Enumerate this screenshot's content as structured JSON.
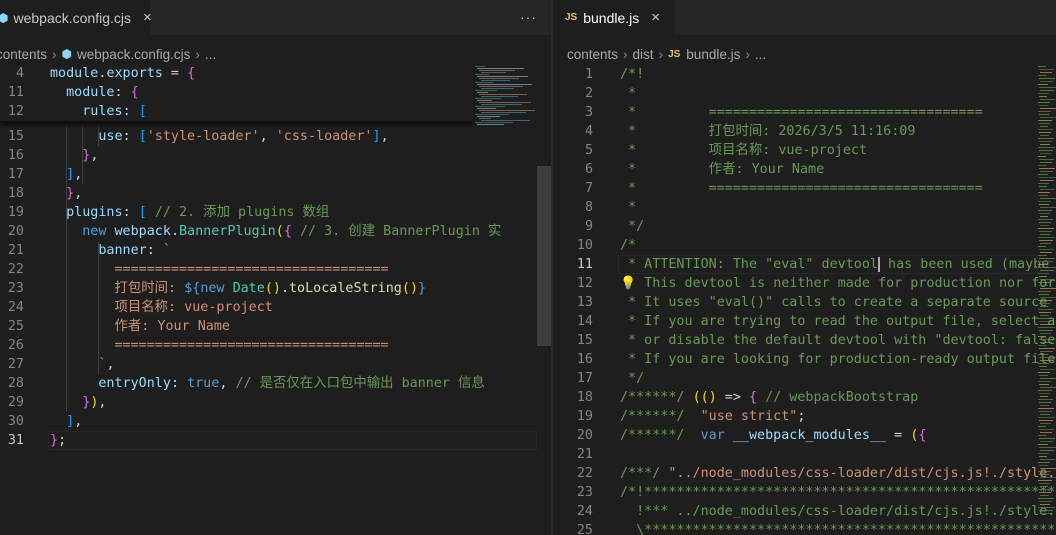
{
  "left_pane": {
    "tab": {
      "icon": "webpack-icon",
      "label": "webpack.config.cjs",
      "close": "×"
    },
    "more": "···",
    "breadcrumb": {
      "items": [
        "contents",
        "webpack.config.cjs",
        "..."
      ]
    },
    "sticky": [
      {
        "ln": "4",
        "code": "module.exports = {"
      },
      {
        "ln": "11",
        "code": "  module: {"
      },
      {
        "ln": "12",
        "code": "    rules: ["
      }
    ],
    "lines": [
      {
        "ln": "15",
        "code": "      use: ['style-loader', 'css-loader'],"
      },
      {
        "ln": "16",
        "code": "    },"
      },
      {
        "ln": "17",
        "code": "  ],"
      },
      {
        "ln": "18",
        "code": "  },"
      },
      {
        "ln": "19",
        "code": "  plugins: [ // 2. 添加 plugins 数组"
      },
      {
        "ln": "20",
        "code": "    new webpack.BannerPlugin({ // 3. 创建 BannerPlugin 实"
      },
      {
        "ln": "21",
        "code": "      banner: `"
      },
      {
        "ln": "22",
        "code": "        =================================="
      },
      {
        "ln": "23",
        "code": "        打包时间: ${new Date().toLocaleString()}"
      },
      {
        "ln": "24",
        "code": "        项目名称: vue-project"
      },
      {
        "ln": "25",
        "code": "        作者: Your Name"
      },
      {
        "ln": "26",
        "code": "        =================================="
      },
      {
        "ln": "27",
        "code": "      `,"
      },
      {
        "ln": "28",
        "code": "      entryOnly: true, // 是否仅在入口包中输出 banner 信息"
      },
      {
        "ln": "29",
        "code": "    }),"
      },
      {
        "ln": "30",
        "code": "  ],"
      },
      {
        "ln": "31",
        "code": "};"
      }
    ]
  },
  "right_pane": {
    "tab": {
      "icon": "JS",
      "label": "bundle.js",
      "close": "×"
    },
    "breadcrumb": {
      "items": [
        "contents",
        "dist",
        "bundle.js",
        "..."
      ],
      "js_icon": "JS"
    },
    "lines": [
      {
        "ln": "1",
        "code": "/*!"
      },
      {
        "ln": "2",
        "code": " *"
      },
      {
        "ln": "3",
        "code": " *         =================================="
      },
      {
        "ln": "4",
        "code": " *         打包时间: 2026/3/5 11:16:09"
      },
      {
        "ln": "5",
        "code": " *         项目名称: vue-project"
      },
      {
        "ln": "6",
        "code": " *         作者: Your Name"
      },
      {
        "ln": "7",
        "code": " *         =================================="
      },
      {
        "ln": "8",
        "code": " *"
      },
      {
        "ln": "9",
        "code": " */"
      },
      {
        "ln": "10",
        "code": "/*"
      },
      {
        "ln": "11",
        "code": " * ATTENTION: The \"eval\" devtool has been used (maybe b"
      },
      {
        "ln": "12",
        "code": " * This devtool is neither made for production nor for"
      },
      {
        "ln": "13",
        "code": " * It uses \"eval()\" calls to create a separate source f"
      },
      {
        "ln": "14",
        "code": " * If you are trying to read the output file, select a"
      },
      {
        "ln": "15",
        "code": " * or disable the default devtool with \"devtool: false\""
      },
      {
        "ln": "16",
        "code": " * If you are looking for production-ready output files"
      },
      {
        "ln": "17",
        "code": " */"
      },
      {
        "ln": "18",
        "code": "/******/ (() => { // webpackBootstrap"
      },
      {
        "ln": "19",
        "code": "/******/  \"use strict\";"
      },
      {
        "ln": "20",
        "code": "/******/  var __webpack_modules__ = ({"
      },
      {
        "ln": "21",
        "code": ""
      },
      {
        "ln": "22",
        "code": "/***/ \"../node_modules/css-loader/dist/cjs.js!./style.c"
      },
      {
        "ln": "23",
        "code": "/*!*******************************************************"
      },
      {
        "ln": "24",
        "code": "  !*** ../node_modules/css-loader/dist/cjs.js!./style.c"
      },
      {
        "ln": "25",
        "code": "  \\******************************************************"
      }
    ]
  }
}
